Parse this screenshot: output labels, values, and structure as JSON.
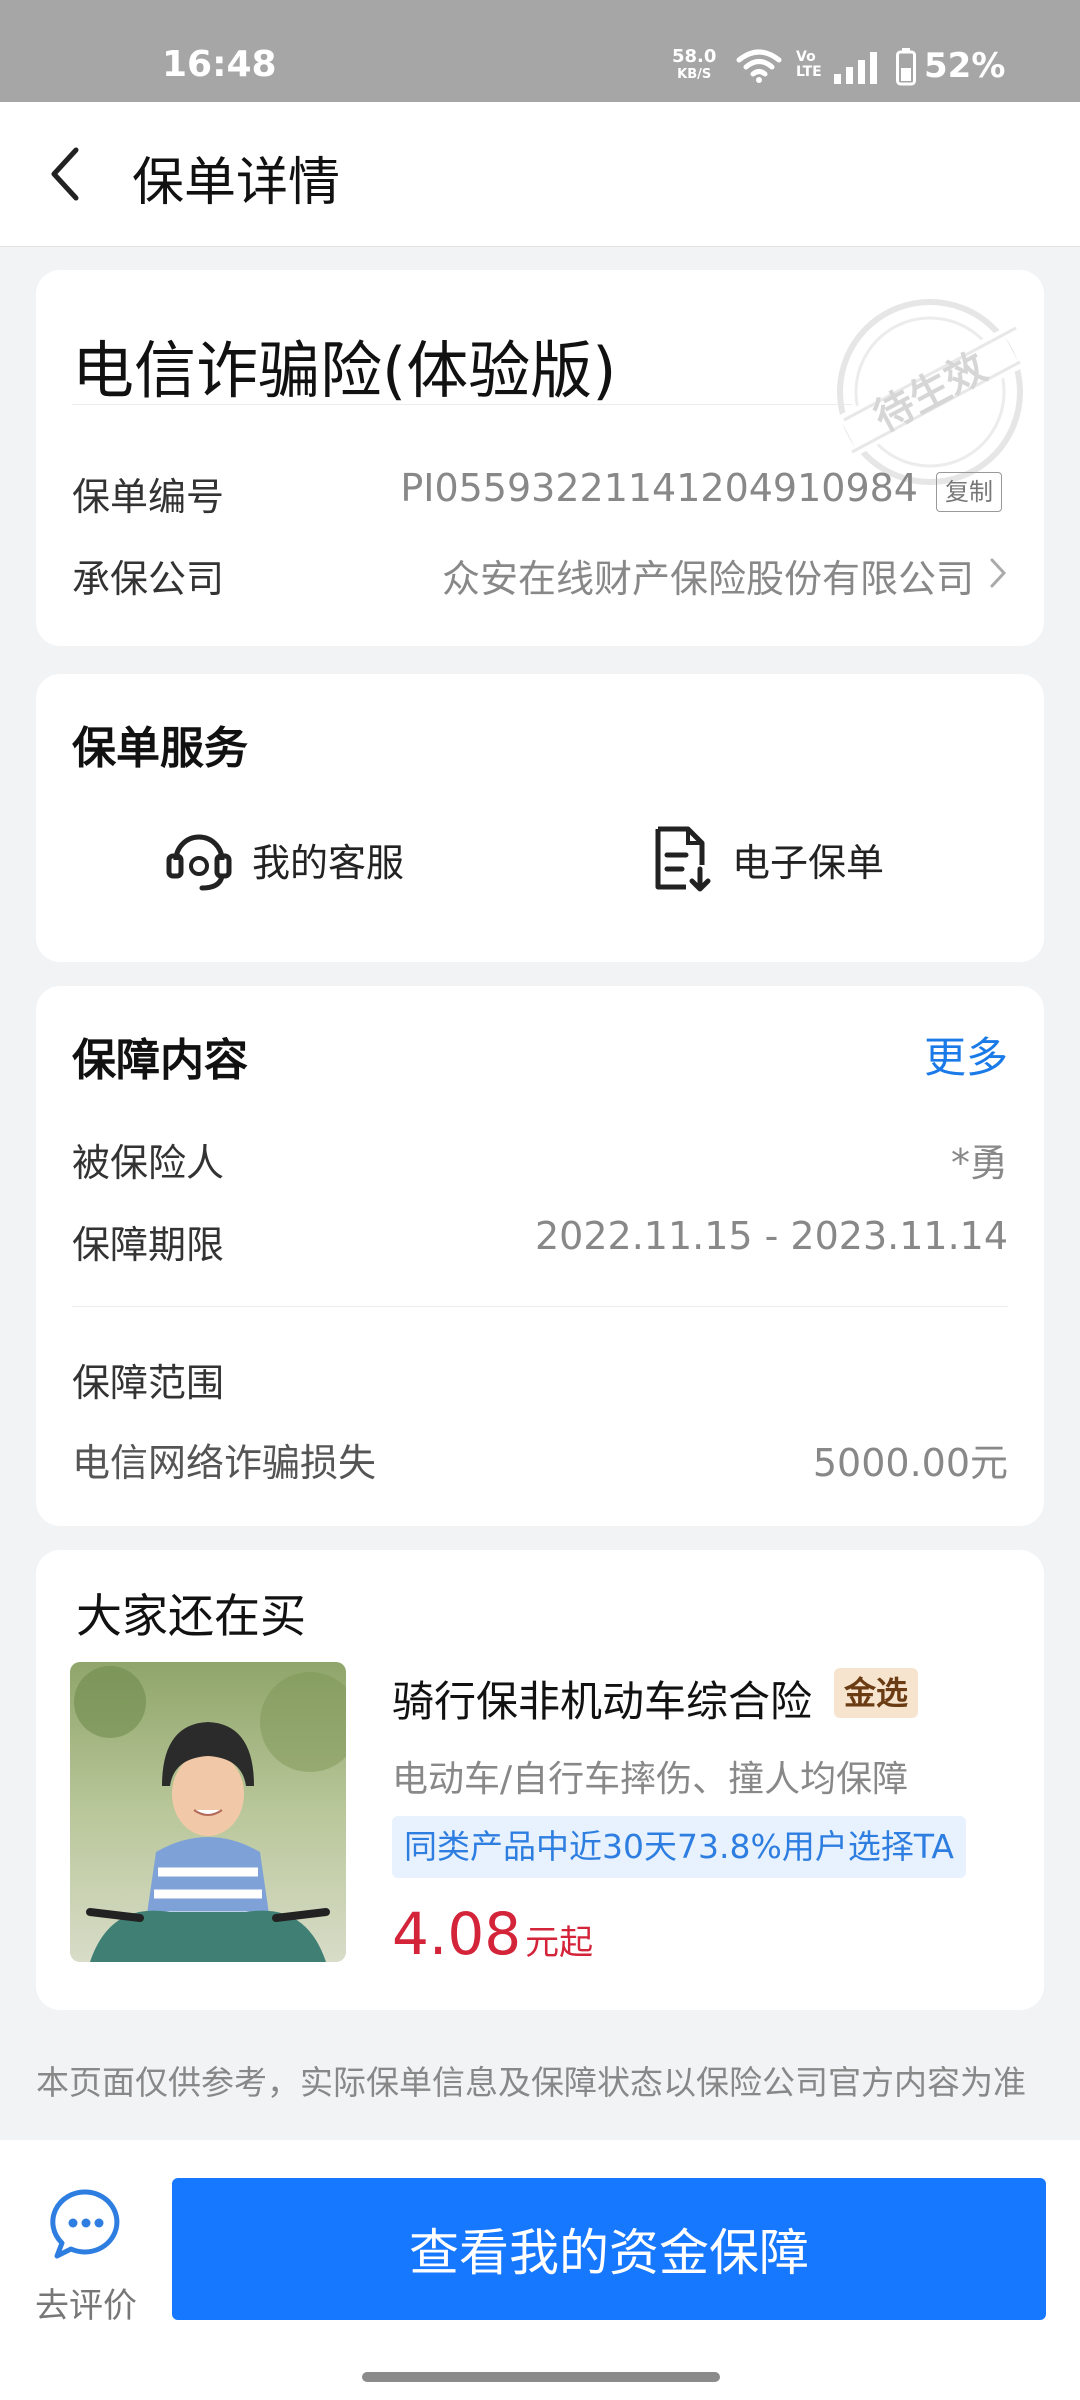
{
  "status_bar": {
    "time": "16:48",
    "net_speed_value": "58.0",
    "net_speed_unit": "KB/S",
    "volte_top": "Vo",
    "volte_bottom": "LTE",
    "battery": "52%"
  },
  "header": {
    "title": "保单详情"
  },
  "policy": {
    "name": "电信诈骗险(体验版)",
    "stamp_text": "待生效",
    "number_label": "保单编号",
    "number_value": "PI0559322114120491098 4",
    "copy_label": "复制",
    "company_label": "承保公司",
    "company_value": "众安在线财产保险股份有限公司"
  },
  "services": {
    "title": "保单服务",
    "items": [
      {
        "label": "我的客服",
        "icon": "headset-icon"
      },
      {
        "label": "电子保单",
        "icon": "document-download-icon"
      }
    ]
  },
  "coverage": {
    "title": "保障内容",
    "more_label": "更多",
    "insured_label": "被保险人",
    "insured_value": "*勇",
    "period_label": "保障期限",
    "period_value": "2022.11.15 - 2023.11.14",
    "scope_label": "保障范围",
    "scope_item_label": "电信网络诈骗损失",
    "scope_item_value": "5000.00元"
  },
  "recommend": {
    "title": "大家还在买",
    "product_name": "骑行保非机动车综合险",
    "tag": "金选",
    "desc": "电动车/自行车摔伤、撞人均保障",
    "badge": "同类产品中近30天73.8%用户选择TA",
    "price": "4.08",
    "price_unit": "元起"
  },
  "disclaimer": "本页面仅供参考，实际保单信息及保障状态以保险公司官方内容为准",
  "bottom": {
    "review_label": "去评价",
    "main_button": "查看我的资金保障"
  },
  "colors": {
    "accent": "#1677ff",
    "link": "#1a7ae8",
    "price": "#d3243a",
    "gold_tag_bg": "#f6e4cf"
  }
}
